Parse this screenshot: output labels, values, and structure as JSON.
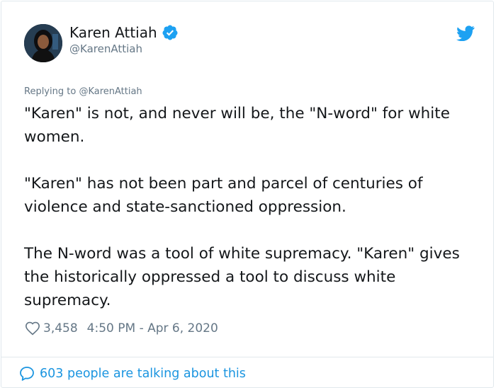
{
  "author": {
    "display_name": "Karen Attiah",
    "handle": "@KarenAttiah",
    "verified": true
  },
  "reply": {
    "prefix": "Replying to",
    "to": "@KarenAttiah"
  },
  "tweet": {
    "paragraphs": [
      "\"Karen\" is not, and never will be, the \"N-word\" for white women.",
      "\"Karen\" has not been part and parcel of centuries of violence and state-sanctioned oppression.",
      "The N-word was a tool of white supremacy. \"Karen\" gives the historically oppressed a tool to discuss white supremacy."
    ]
  },
  "meta": {
    "likes": "3,458",
    "timestamp": "4:50 PM - Apr 6, 2020"
  },
  "footer": {
    "talking_label": "603 people are talking about this"
  },
  "icons": {
    "verified": "verified-badge-icon",
    "brand": "twitter-bird-icon",
    "like": "heart-outline-icon",
    "conversation": "speech-bubble-icon"
  },
  "colors": {
    "text": "#14171a",
    "secondary": "#657786",
    "accent": "#1b95e0",
    "border": "#e1e8ed"
  }
}
